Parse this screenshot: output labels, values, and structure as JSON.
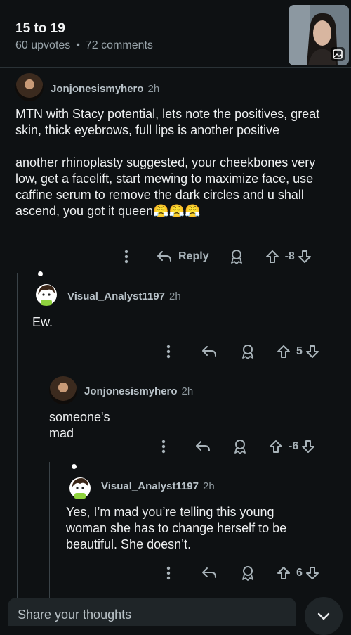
{
  "post": {
    "title": "15 to 19",
    "upvotes": "60 upvotes",
    "comments": "72 comments"
  },
  "comments": [
    {
      "author": "Jonjonesismyhero",
      "age": "2h",
      "body": "MTN with Stacy potential, lets note the positives, great skin, thick eyebrows, full lips is another positive\n\nanother rhinoplasty suggested, your cheekbones very low, get a facelift, start mewing to maximize face, use caffine serum to remove the dark circles and u shall ascend, you got it queen😤😤😤",
      "reply_label": "Reply",
      "score": "-8"
    },
    {
      "author": "Visual_Analyst1197",
      "age": "2h",
      "body": "Ew.",
      "score": "5"
    },
    {
      "author": "Jonjonesismyhero",
      "age": "2h",
      "body": "someone's mad",
      "score": "-6"
    },
    {
      "author": "Visual_Analyst1197",
      "age": "2h",
      "body": "Yes, I’m mad you’re telling this young woman she has to change herself to be beautiful. She doesn’t.",
      "score": "6"
    }
  ],
  "composer": {
    "placeholder": "Share your thoughts"
  },
  "icons": {
    "more": "more-vertical-icon",
    "reply": "reply-arrow-icon",
    "award": "award-icon",
    "upvote": "upvote-icon",
    "downvote": "downvote-icon",
    "collapse": "chevron-down-icon",
    "image": "image-icon"
  }
}
